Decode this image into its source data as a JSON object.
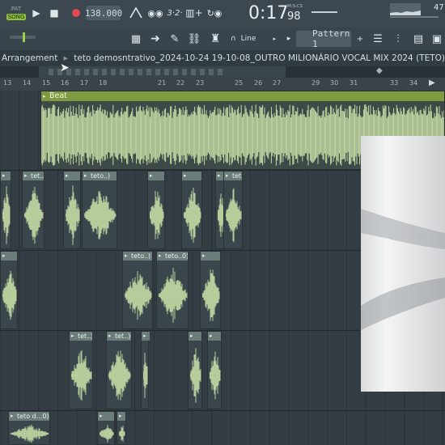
{
  "toolbar": {
    "pat_label": "PAT",
    "song_label": "SONG",
    "tempo": "138.000",
    "time_main": "0:17",
    "time_sub": "98",
    "time_unit": "M:S:CS",
    "cpu_value": "47",
    "snap_label": "Line",
    "pattern_label": "Pattern 1"
  },
  "breadcrumb": {
    "root": "Arrangement",
    "sep": "▸",
    "project": "teto demosntrativo_2024-10-24 19-10-08_OUTRO MILIONÁRIO VOCAL MIX 2024 (TETO)",
    "end": "▸"
  },
  "ruler": {
    "bars": [
      "13",
      "14",
      "15",
      "16",
      "17",
      "18",
      "21",
      "22",
      "23",
      "25",
      "26",
      "27",
      "29",
      "30",
      "31",
      "33",
      "34"
    ]
  },
  "tracks": {
    "beat_clip": "Beat",
    "row2_clips": [
      "",
      "tet..",
      "",
      "teto..)",
      "",
      "",
      "",
      "tet.."
    ],
    "row3_clips": [
      "",
      "teto..)",
      "teto..0)",
      ""
    ],
    "row4_clips": [
      "tet..)",
      "tet..)",
      "",
      "",
      ""
    ],
    "row5_clips": [
      "teto d...0)",
      "",
      ""
    ]
  },
  "colors": {
    "wave": "#c5dba4",
    "beat_header": "#7f9a3f",
    "clip_header": "#6a7d7a",
    "background": "#343d44"
  }
}
